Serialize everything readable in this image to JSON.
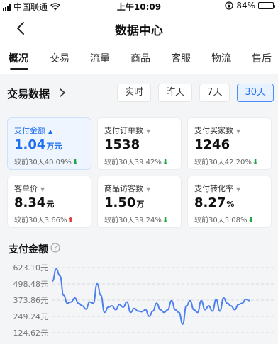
{
  "status_bar": {
    "carrier": "中国联通",
    "time": "上午10:09",
    "battery": "84%",
    "battery_level": 0.84
  },
  "header": {
    "title": "数据中心"
  },
  "tabs": [
    {
      "label": "概况",
      "active": true
    },
    {
      "label": "交易"
    },
    {
      "label": "流量"
    },
    {
      "label": "商品"
    },
    {
      "label": "客服"
    },
    {
      "label": "物流"
    },
    {
      "label": "售后"
    }
  ],
  "trade": {
    "title": "交易数据",
    "periods": [
      {
        "label": "实时"
      },
      {
        "label": "昨天"
      },
      {
        "label": "7天"
      },
      {
        "label": "30天",
        "active": true
      }
    ]
  },
  "metrics": [
    {
      "label": "支付金额",
      "caret": "▲",
      "value": "1.04",
      "unit": "万元",
      "compare": "较前30天40.09%",
      "trend": "down",
      "selected": true
    },
    {
      "label": "支付订单数",
      "caret": "▼",
      "value": "1538",
      "unit": "",
      "compare": "较前30天39.42%",
      "trend": "down"
    },
    {
      "label": "支付买家数",
      "caret": "▼",
      "value": "1246",
      "unit": "",
      "compare": "较前30天42.20%",
      "trend": "down"
    },
    {
      "label": "客单价",
      "caret": "▼",
      "value": "8.34",
      "unit": "元",
      "compare": "较前30天3.66%",
      "trend": "up"
    },
    {
      "label": "商品访客数",
      "caret": "▼",
      "value": "1.50",
      "unit": "万",
      "compare": "较前30天39.24%",
      "trend": "down"
    },
    {
      "label": "支付转化率",
      "caret": "▼",
      "value": "8.27",
      "unit": "%",
      "compare": "较前30天5.08%",
      "trend": "down"
    }
  ],
  "chart": {
    "title": "支付金额"
  },
  "chart_data": {
    "type": "line",
    "yticks": [
      "623.10元",
      "498.48元",
      "373.86元",
      "249.24元",
      "124.62元"
    ],
    "ytick_values": [
      623.1,
      498.48,
      373.86,
      249.24,
      124.62
    ],
    "ylim": [
      124.62,
      623.1
    ],
    "grid": true,
    "color": "#4d7fef",
    "series": [
      {
        "values": [
          520,
          612,
          560,
          410,
          350,
          360,
          390,
          350,
          330,
          305,
          360,
          350,
          500,
          410,
          280,
          320,
          330,
          300,
          340,
          320,
          360,
          280,
          310,
          290,
          285,
          300,
          250,
          290,
          350,
          300,
          280,
          300,
          370,
          300,
          280,
          190,
          330,
          370,
          300,
          280,
          370,
          300,
          330,
          290,
          380,
          290,
          390,
          350,
          330,
          300,
          340,
          350,
          380,
          370
        ]
      }
    ]
  }
}
